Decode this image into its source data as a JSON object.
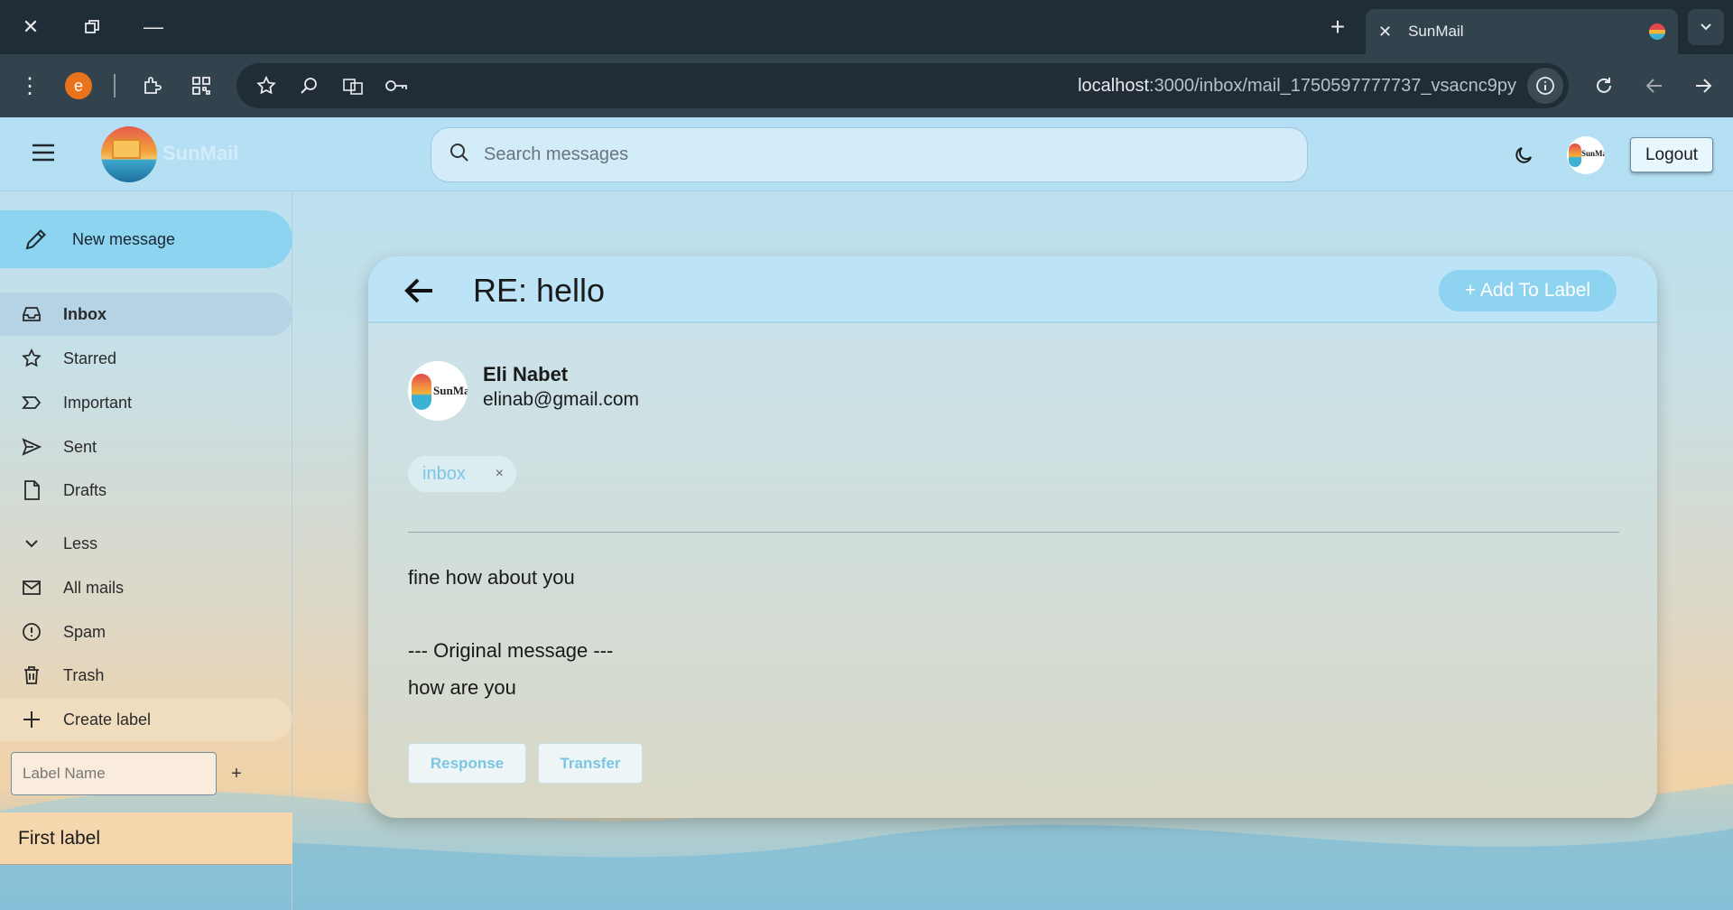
{
  "browser": {
    "tab_title": "SunMail",
    "url_host": "localhost",
    "url_path": ":3000/inbox/mail_1750597777737_vsacnc9py",
    "extension_badge": "e"
  },
  "app": {
    "brand": "SunMail",
    "search_placeholder": "Search messages",
    "logout_label": "Logout",
    "avatar_text": "SunMail"
  },
  "sidebar": {
    "new_message": "New message",
    "items": [
      {
        "label": "Inbox",
        "icon": "inbox-icon",
        "active": true
      },
      {
        "label": "Starred",
        "icon": "star-icon"
      },
      {
        "label": "Important",
        "icon": "important-icon"
      },
      {
        "label": "Sent",
        "icon": "send-icon"
      },
      {
        "label": "Drafts",
        "icon": "draft-icon"
      },
      {
        "label": "Less",
        "icon": "chevron-down-icon"
      },
      {
        "label": "All mails",
        "icon": "mail-icon"
      },
      {
        "label": "Spam",
        "icon": "spam-icon"
      },
      {
        "label": "Trash",
        "icon": "trash-icon"
      },
      {
        "label": "Create label",
        "icon": "plus-icon"
      }
    ],
    "label_input_placeholder": "Label Name",
    "label_add": "+",
    "custom_labels": [
      "First label"
    ]
  },
  "message": {
    "subject": "RE: hello",
    "add_to_label": "+ Add To Label",
    "sender_name": "Eli Nabet",
    "sender_email": "elinab@gmail.com",
    "label_chip": "inbox",
    "label_chip_remove": "×",
    "body_line1": "fine how about you",
    "body_line2": "--- Original message ---",
    "body_line3": "how are you",
    "response_label": "Response",
    "transfer_label": "Transfer"
  },
  "colors": {
    "accent": "#8ed3ef",
    "chrome_dark": "#212d36",
    "chrome_toolbar": "#33434e"
  }
}
